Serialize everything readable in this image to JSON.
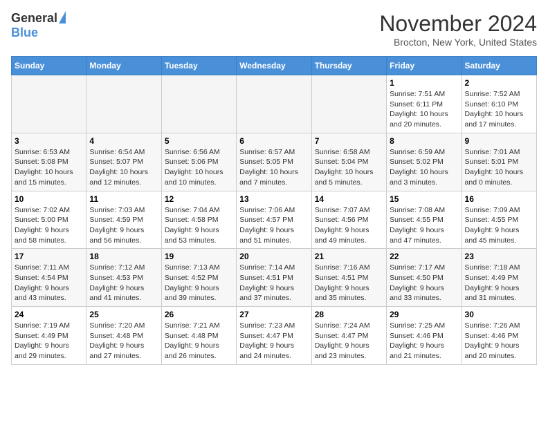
{
  "header": {
    "logo_general": "General",
    "logo_blue": "Blue",
    "month_title": "November 2024",
    "location": "Brocton, New York, United States"
  },
  "weekdays": [
    "Sunday",
    "Monday",
    "Tuesday",
    "Wednesday",
    "Thursday",
    "Friday",
    "Saturday"
  ],
  "weeks": [
    [
      {
        "day": "",
        "empty": true
      },
      {
        "day": "",
        "empty": true
      },
      {
        "day": "",
        "empty": true
      },
      {
        "day": "",
        "empty": true
      },
      {
        "day": "",
        "empty": true
      },
      {
        "day": "1",
        "info": "Sunrise: 7:51 AM\nSunset: 6:11 PM\nDaylight: 10 hours\nand 20 minutes."
      },
      {
        "day": "2",
        "info": "Sunrise: 7:52 AM\nSunset: 6:10 PM\nDaylight: 10 hours\nand 17 minutes."
      }
    ],
    [
      {
        "day": "3",
        "info": "Sunrise: 6:53 AM\nSunset: 5:08 PM\nDaylight: 10 hours\nand 15 minutes."
      },
      {
        "day": "4",
        "info": "Sunrise: 6:54 AM\nSunset: 5:07 PM\nDaylight: 10 hours\nand 12 minutes."
      },
      {
        "day": "5",
        "info": "Sunrise: 6:56 AM\nSunset: 5:06 PM\nDaylight: 10 hours\nand 10 minutes."
      },
      {
        "day": "6",
        "info": "Sunrise: 6:57 AM\nSunset: 5:05 PM\nDaylight: 10 hours\nand 7 minutes."
      },
      {
        "day": "7",
        "info": "Sunrise: 6:58 AM\nSunset: 5:04 PM\nDaylight: 10 hours\nand 5 minutes."
      },
      {
        "day": "8",
        "info": "Sunrise: 6:59 AM\nSunset: 5:02 PM\nDaylight: 10 hours\nand 3 minutes."
      },
      {
        "day": "9",
        "info": "Sunrise: 7:01 AM\nSunset: 5:01 PM\nDaylight: 10 hours\nand 0 minutes."
      }
    ],
    [
      {
        "day": "10",
        "info": "Sunrise: 7:02 AM\nSunset: 5:00 PM\nDaylight: 9 hours\nand 58 minutes."
      },
      {
        "day": "11",
        "info": "Sunrise: 7:03 AM\nSunset: 4:59 PM\nDaylight: 9 hours\nand 56 minutes."
      },
      {
        "day": "12",
        "info": "Sunrise: 7:04 AM\nSunset: 4:58 PM\nDaylight: 9 hours\nand 53 minutes."
      },
      {
        "day": "13",
        "info": "Sunrise: 7:06 AM\nSunset: 4:57 PM\nDaylight: 9 hours\nand 51 minutes."
      },
      {
        "day": "14",
        "info": "Sunrise: 7:07 AM\nSunset: 4:56 PM\nDaylight: 9 hours\nand 49 minutes."
      },
      {
        "day": "15",
        "info": "Sunrise: 7:08 AM\nSunset: 4:55 PM\nDaylight: 9 hours\nand 47 minutes."
      },
      {
        "day": "16",
        "info": "Sunrise: 7:09 AM\nSunset: 4:55 PM\nDaylight: 9 hours\nand 45 minutes."
      }
    ],
    [
      {
        "day": "17",
        "info": "Sunrise: 7:11 AM\nSunset: 4:54 PM\nDaylight: 9 hours\nand 43 minutes."
      },
      {
        "day": "18",
        "info": "Sunrise: 7:12 AM\nSunset: 4:53 PM\nDaylight: 9 hours\nand 41 minutes."
      },
      {
        "day": "19",
        "info": "Sunrise: 7:13 AM\nSunset: 4:52 PM\nDaylight: 9 hours\nand 39 minutes."
      },
      {
        "day": "20",
        "info": "Sunrise: 7:14 AM\nSunset: 4:51 PM\nDaylight: 9 hours\nand 37 minutes."
      },
      {
        "day": "21",
        "info": "Sunrise: 7:16 AM\nSunset: 4:51 PM\nDaylight: 9 hours\nand 35 minutes."
      },
      {
        "day": "22",
        "info": "Sunrise: 7:17 AM\nSunset: 4:50 PM\nDaylight: 9 hours\nand 33 minutes."
      },
      {
        "day": "23",
        "info": "Sunrise: 7:18 AM\nSunset: 4:49 PM\nDaylight: 9 hours\nand 31 minutes."
      }
    ],
    [
      {
        "day": "24",
        "info": "Sunrise: 7:19 AM\nSunset: 4:49 PM\nDaylight: 9 hours\nand 29 minutes."
      },
      {
        "day": "25",
        "info": "Sunrise: 7:20 AM\nSunset: 4:48 PM\nDaylight: 9 hours\nand 27 minutes."
      },
      {
        "day": "26",
        "info": "Sunrise: 7:21 AM\nSunset: 4:48 PM\nDaylight: 9 hours\nand 26 minutes."
      },
      {
        "day": "27",
        "info": "Sunrise: 7:23 AM\nSunset: 4:47 PM\nDaylight: 9 hours\nand 24 minutes."
      },
      {
        "day": "28",
        "info": "Sunrise: 7:24 AM\nSunset: 4:47 PM\nDaylight: 9 hours\nand 23 minutes."
      },
      {
        "day": "29",
        "info": "Sunrise: 7:25 AM\nSunset: 4:46 PM\nDaylight: 9 hours\nand 21 minutes."
      },
      {
        "day": "30",
        "info": "Sunrise: 7:26 AM\nSunset: 4:46 PM\nDaylight: 9 hours\nand 20 minutes."
      }
    ]
  ]
}
